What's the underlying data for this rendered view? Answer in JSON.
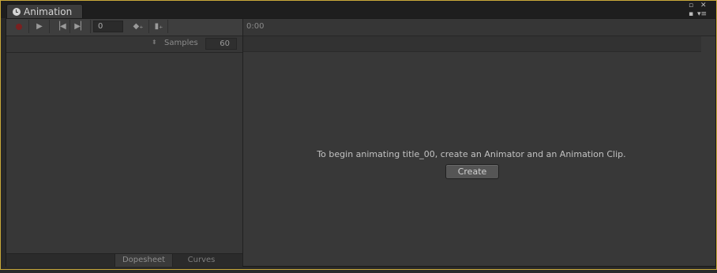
{
  "window": {
    "tab_title": "Animation",
    "accent_border": "#c9a93a"
  },
  "toolbar": {
    "frame_value": "0",
    "samples_label": "Samples",
    "samples_value": "60"
  },
  "timeline": {
    "time_label": "0:00"
  },
  "main": {
    "message": "To begin animating title_00, create an Animator and an Animation Clip.",
    "create_label": "Create"
  },
  "bottom_tabs": [
    {
      "label": "Dopesheet",
      "active": true
    },
    {
      "label": "Curves",
      "active": false
    }
  ]
}
